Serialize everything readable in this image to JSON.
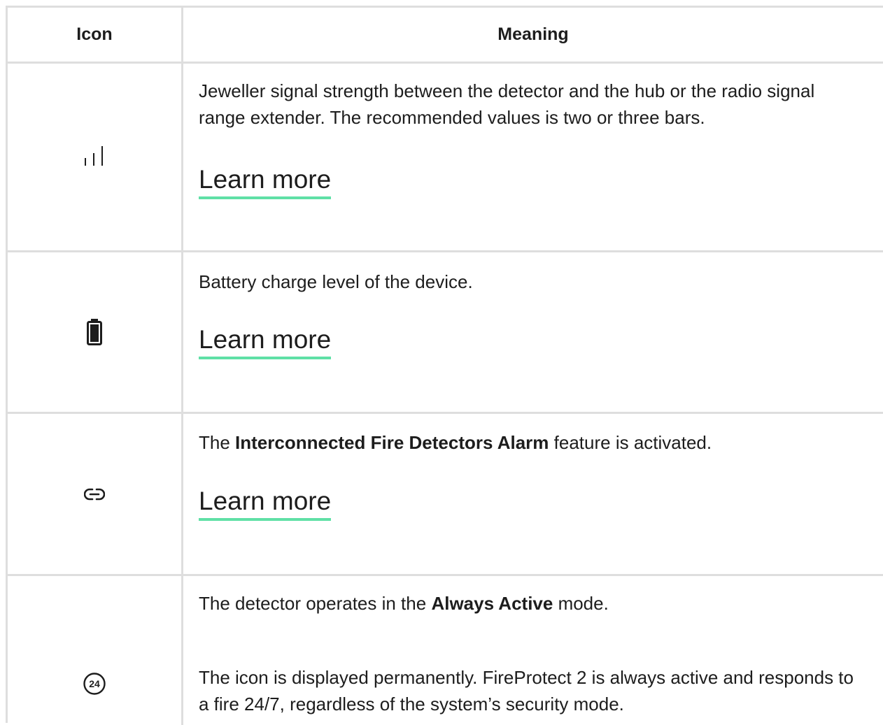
{
  "header": {
    "icon_col": "Icon",
    "meaning_col": "Meaning"
  },
  "rows": [
    {
      "icon": "signal-strength-icon",
      "text": "Jeweller signal strength between the detector and the hub or the radio signal range extender. The recommended values is two or three bars.",
      "link": "Learn more"
    },
    {
      "icon": "battery-icon",
      "text": "Battery charge level of the device.",
      "link": "Learn more"
    },
    {
      "icon": "link-icon",
      "text_before": "The ",
      "text_bold": "Interconnected Fire Detectors Alarm",
      "text_after": " feature is activated.",
      "link": "Learn more"
    },
    {
      "icon": "always-active-24-icon",
      "icon_label": "24",
      "text_before": "The detector operates in the ",
      "text_bold": "Always Active",
      "text_after": " mode.",
      "text2": "The icon is displayed permanently. FireProtect 2 is always active and responds to a fire 24/7, regardless of the system’s security mode."
    }
  ],
  "colors": {
    "border": "#dedede",
    "link_underline": "#5fe0a6",
    "text": "#1d1d1d"
  }
}
